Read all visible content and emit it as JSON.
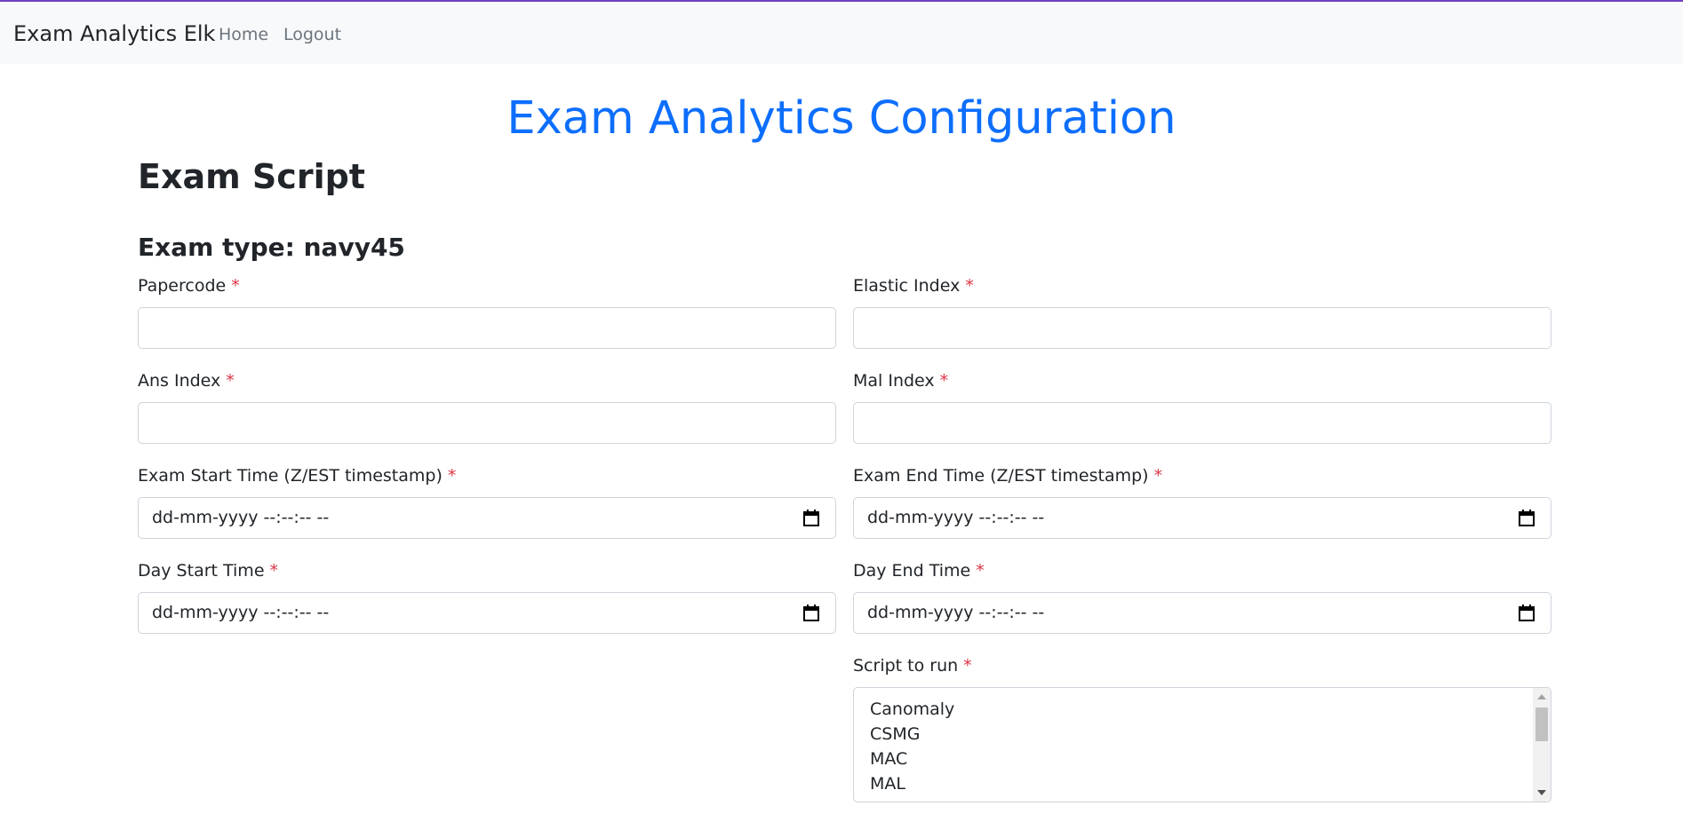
{
  "colors": {
    "accent": "#0d6efd",
    "required": "#dc3545",
    "topline": "#6f42c1"
  },
  "navbar": {
    "brand": "Exam Analytics Elk",
    "home": "Home",
    "logout": "Logout"
  },
  "page": {
    "title": "Exam Analytics Configuration",
    "section": "Exam Script",
    "exam_type_label": "Exam type: navy45"
  },
  "form": {
    "required_marker": "*",
    "papercode": {
      "label": "Papercode",
      "value": ""
    },
    "elastic_index": {
      "label": "Elastic Index",
      "value": ""
    },
    "ans_index": {
      "label": "Ans Index",
      "value": ""
    },
    "mal_index": {
      "label": "Mal Index",
      "value": ""
    },
    "exam_start": {
      "label": "Exam Start Time (Z/EST timestamp)",
      "placeholder": "dd-mm-yyyy --:--:-- --"
    },
    "exam_end": {
      "label": "Exam End Time (Z/EST timestamp)",
      "placeholder": "dd-mm-yyyy --:--:-- --"
    },
    "day_start": {
      "label": "Day Start Time",
      "placeholder": "dd-mm-yyyy --:--:-- --"
    },
    "day_end": {
      "label": "Day End Time",
      "placeholder": "dd-mm-yyyy --:--:-- --"
    },
    "script": {
      "label": "Script to run",
      "options": [
        "Canomaly",
        "CSMG",
        "MAC",
        "MAL"
      ]
    }
  },
  "icons": {
    "calendar": "calendar-icon"
  }
}
